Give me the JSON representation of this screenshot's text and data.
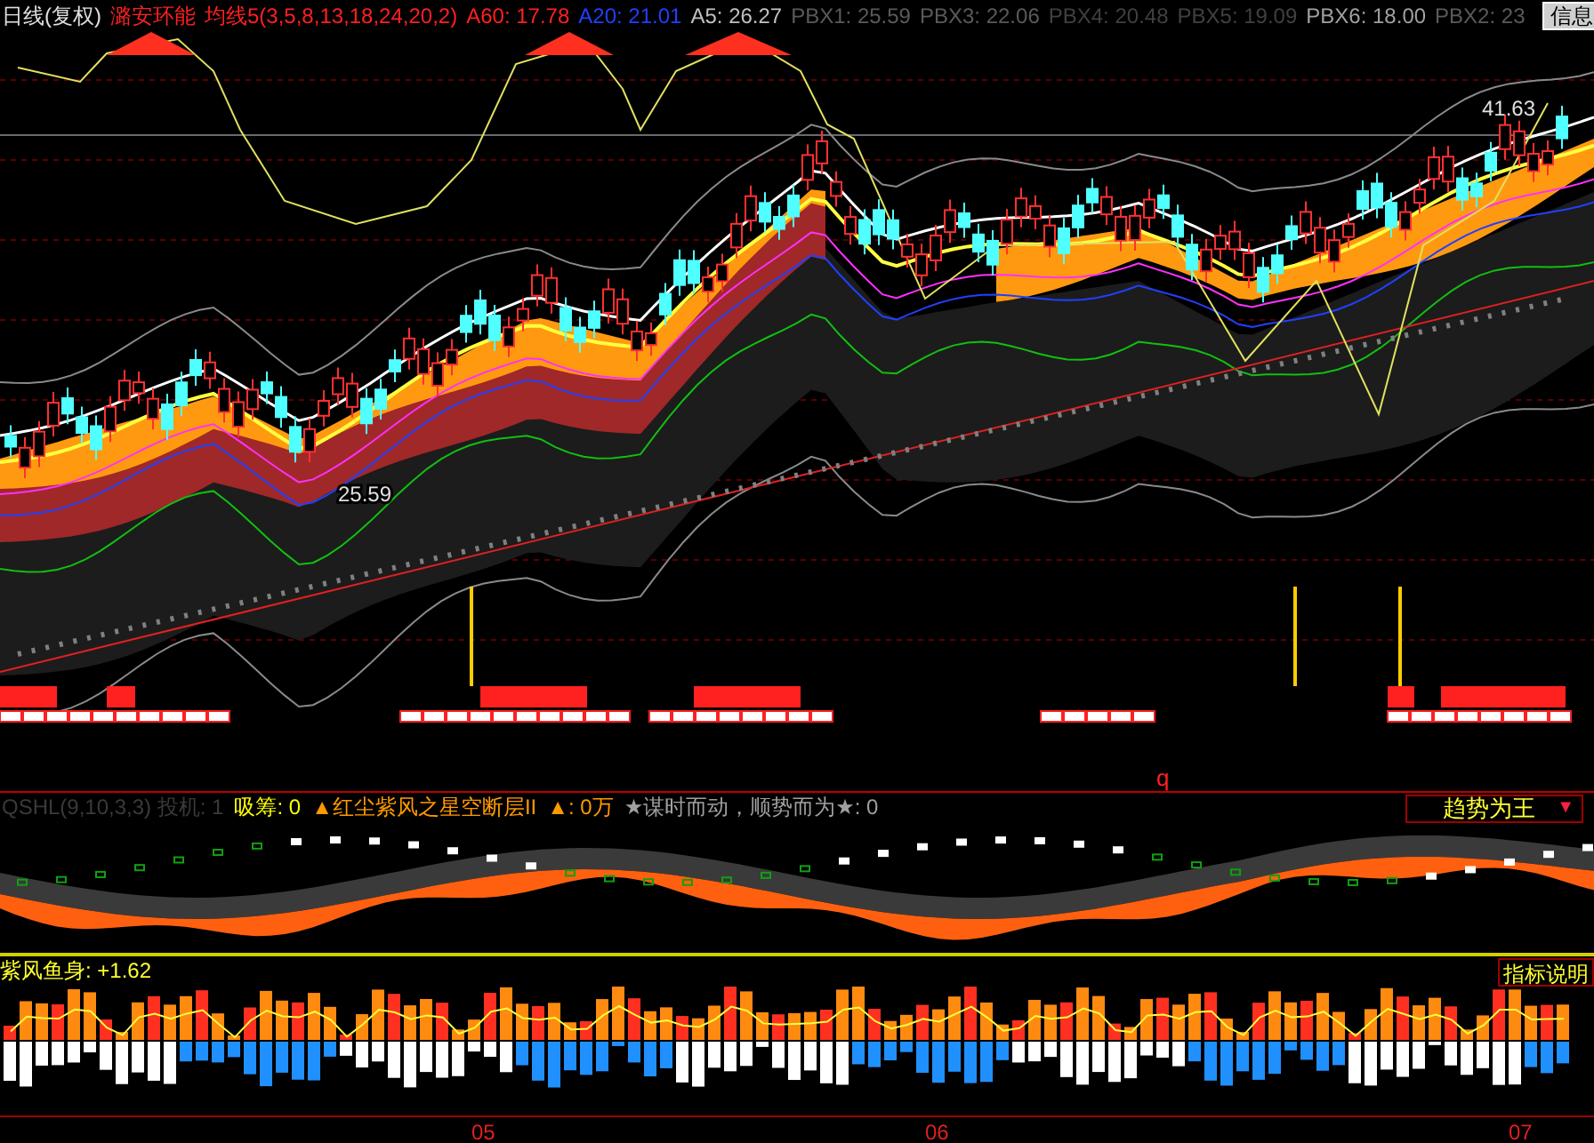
{
  "header": {
    "period": "日线(复权)",
    "stock": "潞安环能",
    "ma_label": "均线5(3,5,8,13,18,24,20,2)",
    "readings": [
      {
        "text": "A60: 17.78",
        "color": "#ff2020"
      },
      {
        "text": "A20: 21.01",
        "color": "#2040ff"
      },
      {
        "text": "A5: 26.27",
        "color": "#c0c0c0"
      },
      {
        "text": "PBX1: 25.59",
        "color": "#5a5a5a"
      },
      {
        "text": "PBX3: 22.06",
        "color": "#5a5a5a"
      },
      {
        "text": "PBX4: 20.48",
        "color": "#404040"
      },
      {
        "text": "PBX5: 19.09",
        "color": "#404040"
      },
      {
        "text": "PBX6: 18.00",
        "color": "#a0a0a0"
      },
      {
        "text": "PBX2: 23",
        "color": "#5a5a5a"
      }
    ],
    "info_button": "信息"
  },
  "main_chart": {
    "high_label": "41.63",
    "low_label": "25.59",
    "marker": "q"
  },
  "indicator1": {
    "params": "QSHL(9,10,3,3) 投机: 1",
    "items": [
      {
        "text": "吸筹: 0",
        "color": "#ffff00"
      },
      {
        "text": "▲红尘紫风之星空断层II",
        "color": "#ff9900"
      },
      {
        "text": "▲: 0万",
        "color": "#ff9900"
      },
      {
        "text": "★谋时而动，顺势而为★: 0",
        "color": "#a0a0a0"
      }
    ],
    "selector": "趋势为王",
    "selector_arrow": "▼"
  },
  "indicator2": {
    "title": "紫风鱼身: +1.62",
    "help": "指标说明"
  },
  "axis": {
    "labels": [
      "05",
      "06",
      "07"
    ]
  }
}
